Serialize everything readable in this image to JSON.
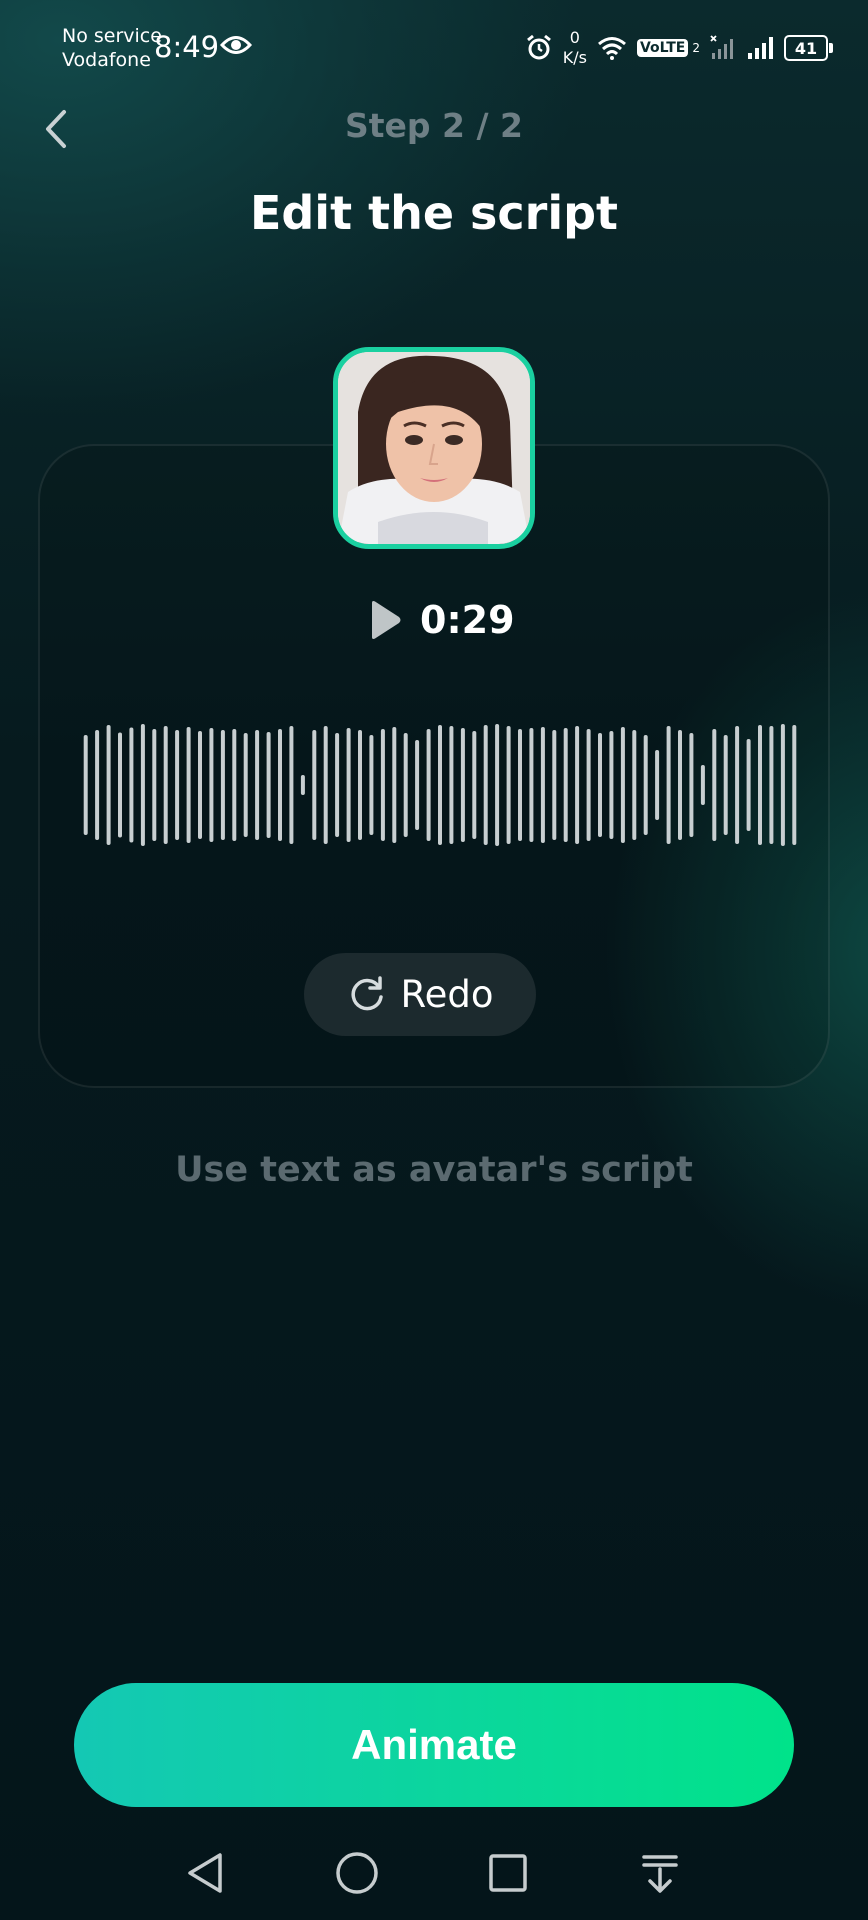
{
  "status_bar": {
    "carrier_line1": "No service",
    "carrier_line2": "Vodafone",
    "time": "8:49",
    "net_speed_value": "0",
    "net_speed_unit": "K/s",
    "volte": "VoLTE",
    "sim": "2",
    "battery": "41"
  },
  "header": {
    "step": "Step 2 / 2",
    "title": "Edit the script"
  },
  "audio": {
    "duration": "0:29",
    "redo_label": "Redo"
  },
  "hint": "Use text as avatar's script",
  "animate_label": "Animate",
  "colors": {
    "accent": "#1ad0a0",
    "button_start": "#14c8b4",
    "button_end": "#00e38a"
  },
  "icons": [
    "back-chevron-icon",
    "play-icon",
    "redo-icon",
    "nav-back-icon",
    "nav-home-icon",
    "nav-recents-icon",
    "nav-menu-icon"
  ]
}
